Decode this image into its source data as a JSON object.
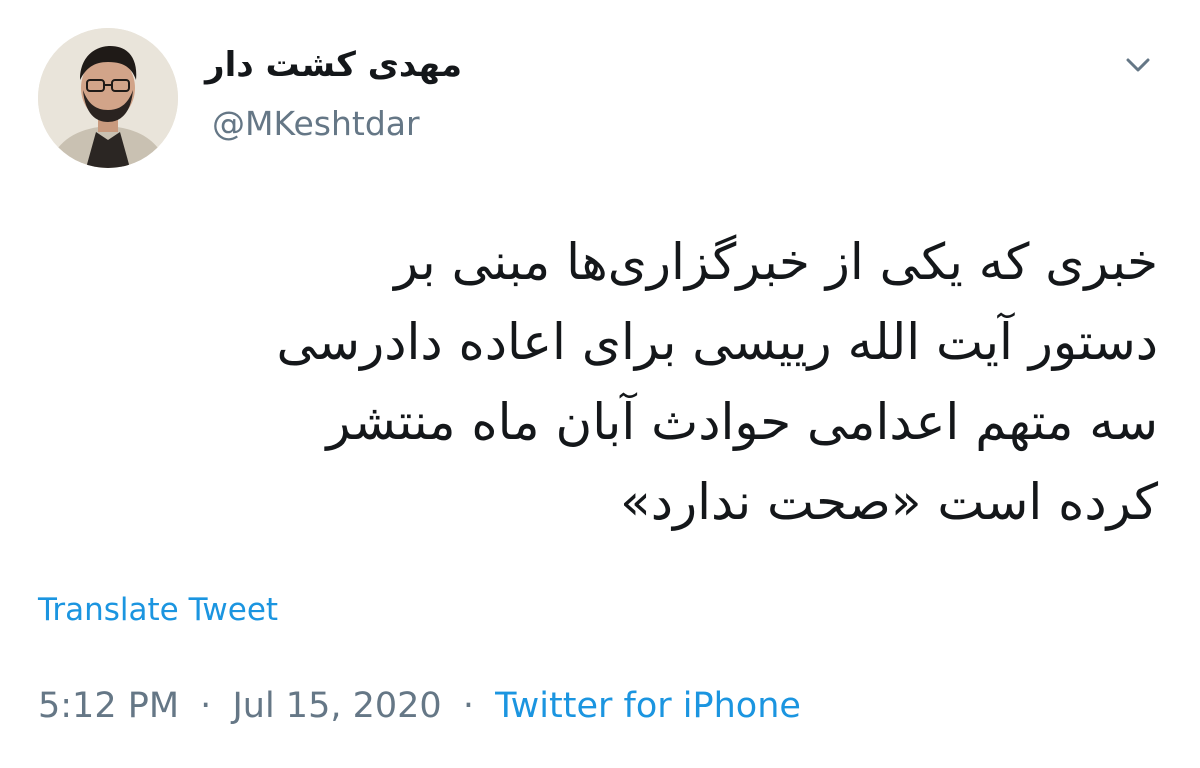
{
  "author": {
    "display_name": "مهدی کشت دار",
    "handle": "@MKeshtdar",
    "avatar_icon": "profile-photo"
  },
  "menu": {
    "icon": "chevron-down-icon"
  },
  "tweet": {
    "text_lines": [
      "خبری که یکی از خبرگزاری‌ها مبنی بر",
      "دستور آیت الله رییسی برای اعاده دادرسی",
      "سه متهم اعدامی حوادث آبان ماه منتشر",
      "کرده است «صحت ندارد»"
    ],
    "translate_label": "Translate Tweet"
  },
  "meta": {
    "time": "5:12 PM",
    "separator": "·",
    "date": "Jul 15, 2020",
    "source": "Twitter for iPhone"
  },
  "colors": {
    "link": "#1b95e0",
    "secondary_text": "#657786",
    "primary_text": "#14171a"
  }
}
